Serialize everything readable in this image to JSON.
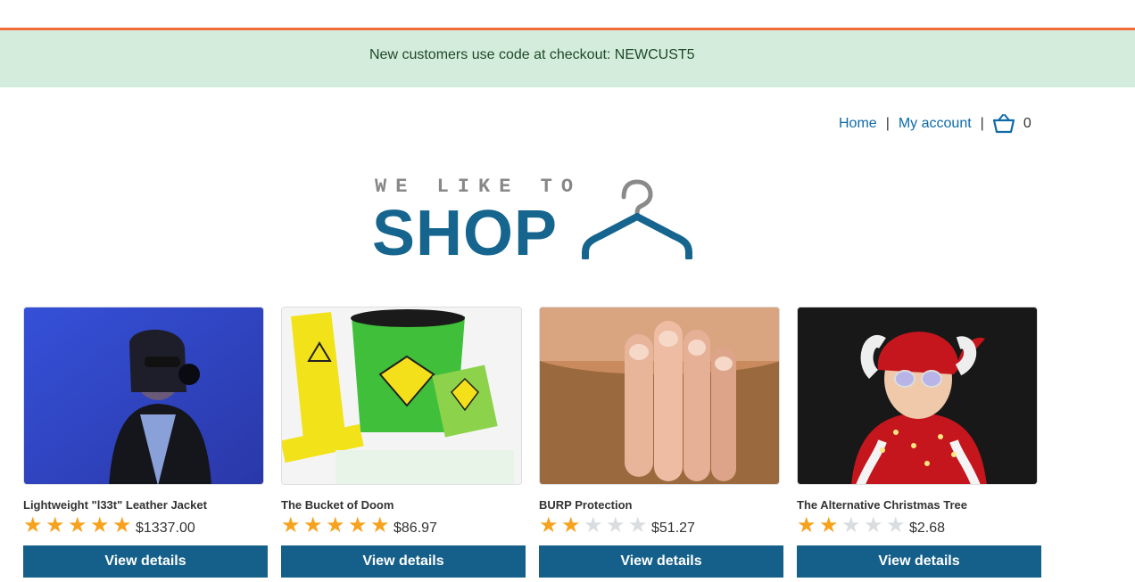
{
  "promo": {
    "text": "New customers use code at checkout: NEWCUST5"
  },
  "nav": {
    "home": "Home",
    "separator": "|",
    "account": "My account",
    "cart_count": "0"
  },
  "logo": {
    "top_text": "WE LIKE TO",
    "main_text": "SHOP"
  },
  "colors": {
    "accent": "#f26b3a",
    "promo_bg": "#d4ecdb",
    "brand": "#15658e",
    "button": "#15608a",
    "star": "#f7a21d"
  },
  "products": [
    {
      "name": "Lightweight \"l33t\" Leather Jacket",
      "rating": 5,
      "price": "$1337.00",
      "button": "View details"
    },
    {
      "name": "The Bucket of Doom",
      "rating": 5,
      "price": "$86.97",
      "button": "View details"
    },
    {
      "name": "BURP Protection",
      "rating": 2,
      "price": "$51.27",
      "button": "View details"
    },
    {
      "name": "The Alternative Christmas Tree",
      "rating": 2,
      "price": "$2.68",
      "button": "View details"
    }
  ],
  "star_max": 5,
  "icons": {
    "cart": "basket-icon",
    "star": "star-icon"
  }
}
